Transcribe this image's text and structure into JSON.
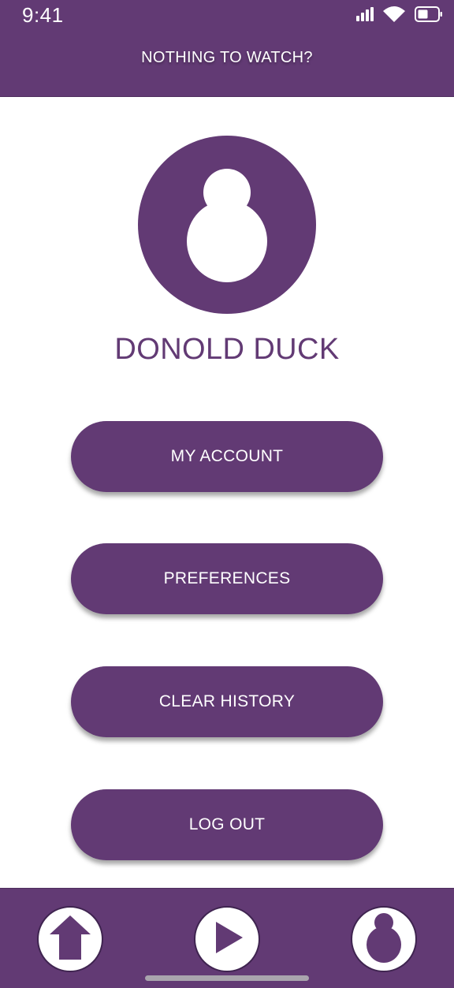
{
  "status_bar": {
    "time": "9:41",
    "icons": [
      "signal-icon",
      "wifi-icon",
      "battery-icon"
    ]
  },
  "header": {
    "title": "NOTHING TO WATCH?"
  },
  "profile": {
    "name": "DONOLD DUCK",
    "avatar_icon": "user-avatar-icon"
  },
  "menu": {
    "my_account": "MY ACCOUNT",
    "preferences": "PREFERENCES",
    "clear_history": "CLEAR HISTORY",
    "log_out": "LOG OUT"
  },
  "bottom_nav": {
    "items": [
      "home-icon",
      "play-icon",
      "profile-icon"
    ]
  },
  "colors": {
    "brand_purple": "#623A74",
    "white": "#ffffff"
  }
}
